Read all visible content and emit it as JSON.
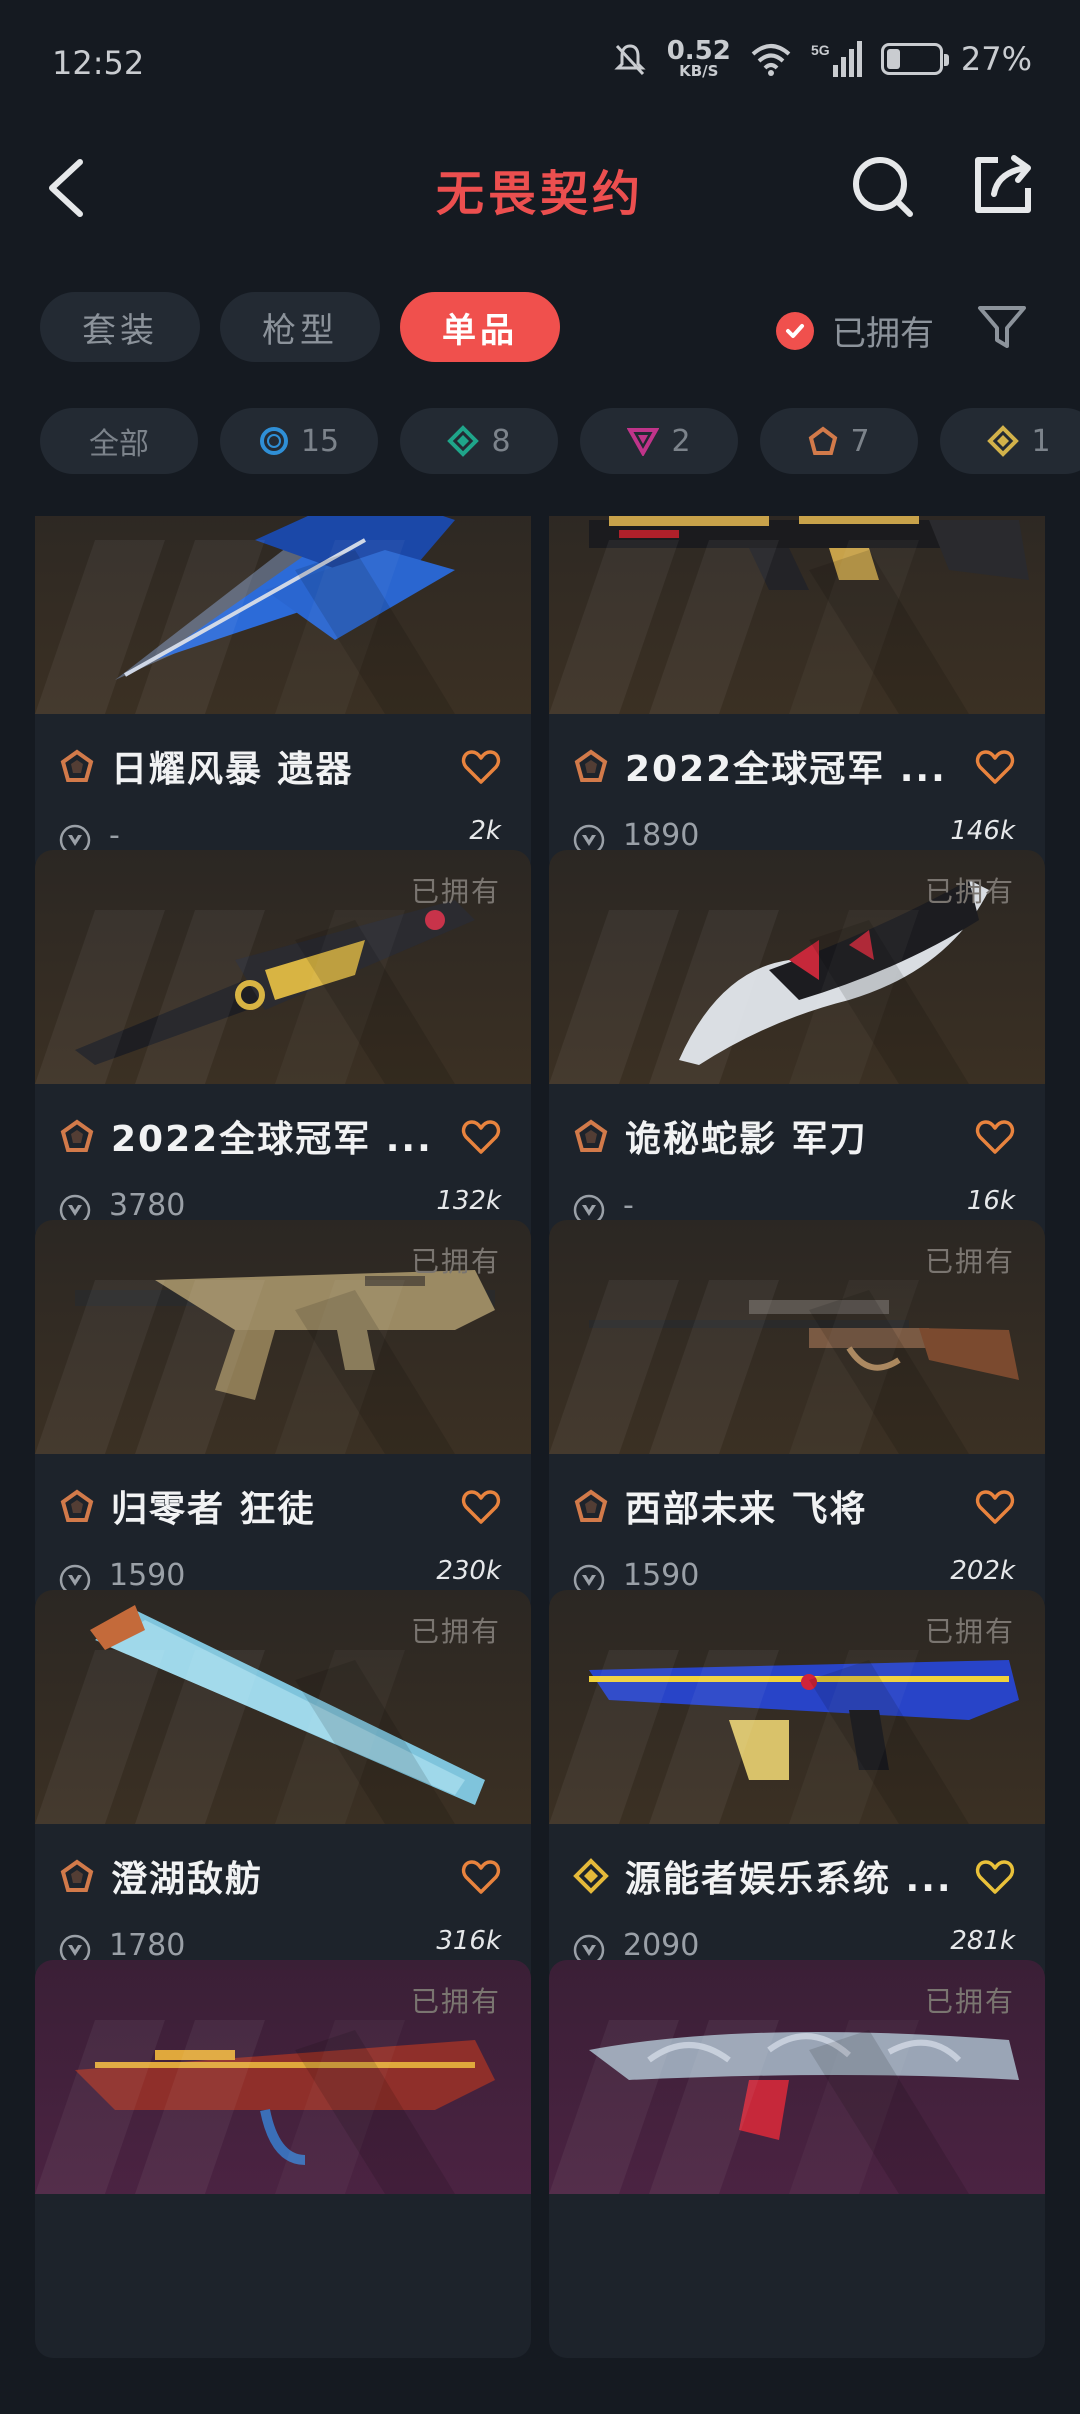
{
  "status": {
    "time": "12:52",
    "net_speed": "0.52",
    "net_unit": "KB/S",
    "network": "5G",
    "battery": "27%",
    "battery_level": 0.27
  },
  "header": {
    "title": "无畏契约"
  },
  "tabs": [
    {
      "label": "套装",
      "active": false
    },
    {
      "label": "枪型",
      "active": false
    },
    {
      "label": "单品",
      "active": true
    }
  ],
  "owned_filter": {
    "label": "已拥有",
    "checked": true
  },
  "chips": [
    {
      "label": "全部",
      "icon": ""
    },
    {
      "label": "15",
      "icon": "circle-tier-icon",
      "color": "#2f8fd6"
    },
    {
      "label": "8",
      "icon": "diamond-tier-icon",
      "color": "#1fa58a"
    },
    {
      "label": "2",
      "icon": "triangle-tier-icon",
      "color": "#c0348a"
    },
    {
      "label": "7",
      "icon": "pentagon-tier-icon",
      "color": "#d27a4a"
    },
    {
      "label": "1",
      "icon": "rhombus-tier-icon",
      "color": "#d2b24a"
    }
  ],
  "colors": {
    "accent": "#f0504d",
    "heart_orange": "#e8833e",
    "heart_gold": "#e9c13a",
    "tier_orange": "#d27a4a",
    "tier_gold": "#e5b93a"
  },
  "items": [
    {
      "title": "日耀风暴 遗器",
      "price": "-",
      "likes": "2k",
      "owned": "",
      "tier": "pentagon",
      "weapon": "knife-blue",
      "bg": "gold"
    },
    {
      "title": "2022全球冠军 ...",
      "price": "1890",
      "likes": "146k",
      "owned": "",
      "tier": "pentagon",
      "weapon": "rifle-black",
      "bg": "gold"
    },
    {
      "title": "2022全球冠军 ...",
      "price": "3780",
      "likes": "132k",
      "owned": "已拥有",
      "tier": "pentagon",
      "weapon": "knife-gold",
      "bg": "gold"
    },
    {
      "title": "诡秘蛇影 军刀",
      "price": "-",
      "likes": "16k",
      "owned": "已拥有",
      "tier": "pentagon",
      "weapon": "karambit",
      "bg": "gold"
    },
    {
      "title": "归零者 狂徒",
      "price": "1590",
      "likes": "230k",
      "owned": "已拥有",
      "tier": "pentagon",
      "weapon": "rifle-tan",
      "bg": "gold"
    },
    {
      "title": "西部未来 飞将",
      "price": "1590",
      "likes": "202k",
      "owned": "已拥有",
      "tier": "pentagon",
      "weapon": "lever-rifle",
      "bg": "gold"
    },
    {
      "title": "澄湖敌舫",
      "price": "1780",
      "likes": "316k",
      "owned": "已拥有",
      "tier": "pentagon",
      "weapon": "fan-blade",
      "bg": "gold"
    },
    {
      "title": "源能者娱乐系统 ...",
      "price": "2090",
      "likes": "281k",
      "owned": "已拥有",
      "tier": "rhombus",
      "weapon": "rifle-blue",
      "bg": "gold"
    },
    {
      "title": "",
      "price": "",
      "likes": "",
      "owned": "已拥有",
      "tier": "",
      "weapon": "rifle-red",
      "bg": "purple"
    },
    {
      "title": "",
      "price": "",
      "likes": "",
      "owned": "已拥有",
      "tier": "",
      "weapon": "rifle-silver",
      "bg": "purple"
    }
  ]
}
